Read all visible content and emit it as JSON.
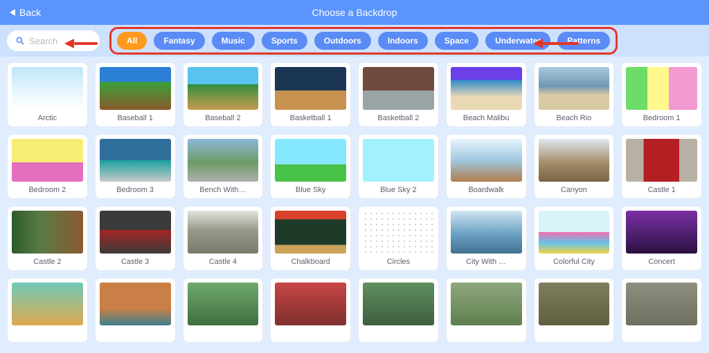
{
  "header": {
    "back_label": "Back",
    "title": "Choose a Backdrop"
  },
  "search": {
    "placeholder": "Search"
  },
  "categories": [
    {
      "label": "All",
      "active": true
    },
    {
      "label": "Fantasy",
      "active": false
    },
    {
      "label": "Music",
      "active": false
    },
    {
      "label": "Sports",
      "active": false
    },
    {
      "label": "Outdoors",
      "active": false
    },
    {
      "label": "Indoors",
      "active": false
    },
    {
      "label": "Space",
      "active": false
    },
    {
      "label": "Underwater",
      "active": false
    },
    {
      "label": "Patterns",
      "active": false
    }
  ],
  "backdrops": [
    {
      "label": "Arctic",
      "bg": "linear-gradient(180deg,#bfe6f7 0%,#e9f6fd 60%,#ffffff 100%)"
    },
    {
      "label": "Baseball 1",
      "bg": "linear-gradient(180deg,#2b7fd6 0%,#2b7fd6 35%,#3aa13a 35%,#8a5a2a 100%)"
    },
    {
      "label": "Baseball 2",
      "bg": "linear-gradient(180deg,#59c2ee 0%,#59c2ee 40%,#2f8f3a 40%,#c79a52 100%)"
    },
    {
      "label": "Basketball 1",
      "bg": "linear-gradient(180deg,#1b3555 0%,#1b3555 55%,#c7924f 55%,#c7924f 100%)"
    },
    {
      "label": "Basketball 2",
      "bg": "linear-gradient(180deg,#6e4b3e 0%,#6e4b3e 55%,#9aa4a6 55%,#9aa4a6 100%)"
    },
    {
      "label": "Beach Malibu",
      "bg": "linear-gradient(180deg,#6b3ee8 0%,#6b3ee8 30%,#2d88c9 30%,#e9d9b4 70%,#e9d9b4 100%)"
    },
    {
      "label": "Beach Rio",
      "bg": "linear-gradient(180deg,#a9c9de 0%,#7198b3 45%,#d9c9a4 65%,#d9c9a4 100%)"
    },
    {
      "label": "Bedroom 1",
      "bg": "linear-gradient(90deg,#6edc68 0%,#6edc68 30%,#fff88a 30%,#fff88a 60%,#f49ad2 60%,#f49ad2 100%)"
    },
    {
      "label": "Bedroom 2",
      "bg": "linear-gradient(180deg,#f7ed74 0%,#f7ed74 55%,#e46fbe 55%,#e46fbe 100%)"
    },
    {
      "label": "Bedroom 3",
      "bg": "linear-gradient(180deg,#2f6f9c 0%,#2f6f9c 50%,#1aa0a0 50%,#c9c9c9 100%)"
    },
    {
      "label": "Bench With…",
      "bg": "linear-gradient(180deg,#8cb8d8 0%,#6b9a66 55%,#b0b0b0 100%)"
    },
    {
      "label": "Blue Sky",
      "bg": "linear-gradient(180deg,#86e8ff 0%,#86e8ff 60%,#49c24a 60%,#49c24a 100%)"
    },
    {
      "label": "Blue Sky 2",
      "bg": "linear-gradient(180deg,#a2f2fd 0%,#a2f2fd 100%)"
    },
    {
      "label": "Boardwalk",
      "bg": "linear-gradient(180deg,#e8f4fb 0%,#9fc8e0 50%,#b07c4e 100%)"
    },
    {
      "label": "Canyon",
      "bg": "linear-gradient(180deg,#dfeaf2 0%,#a58e6a 55%,#7a6347 100%)"
    },
    {
      "label": "Castle 1",
      "bg": "linear-gradient(90deg,#b8b0a4 0%,#b8b0a4 25%,#b41f24 25%,#b41f24 75%,#b8b0a4 75%,#b8b0a4 100%)"
    },
    {
      "label": "Castle 2",
      "bg": "linear-gradient(90deg,#2d5a2a 0%,#5a7a45 40%,#8a5a33 100%)"
    },
    {
      "label": "Castle 3",
      "bg": "linear-gradient(180deg,#3b3b3b 0%,#3b3b3b 45%,#a52424 45%,#3b3b3b 100%)"
    },
    {
      "label": "Castle 4",
      "bg": "linear-gradient(180deg,#e2e4e0 0%,#9a9a8a 45%,#7a7a6a 100%)"
    },
    {
      "label": "Chalkboard",
      "bg": "linear-gradient(180deg,#d9412b 0%,#d9412b 20%,#1e3b2a 20%,#1e3b2a 80%,#caa25a 80%)"
    },
    {
      "label": "Circles",
      "bg": "radial-gradient(circle,#bdbdbd 1px,transparent 1px) 0 0/8px 8px,#fff"
    },
    {
      "label": "City With …",
      "bg": "linear-gradient(180deg,#cfe6f2 0%,#6aa0c4 55%,#43718f 100%)"
    },
    {
      "label": "Colorful City",
      "bg": "linear-gradient(180deg,#d9f3fb 0%,#d9f3fb 50%,#f26fb1 50%,#62c4e6 75%,#f2d14a 100%)"
    },
    {
      "label": "Concert",
      "bg": "linear-gradient(180deg,#7a2fa3 0%,#4a1f6b 60%,#2a0f3f 100%)"
    },
    {
      "label": "",
      "bg": "linear-gradient(180deg,#6fcab8 0%,#e0a94e 100%)"
    },
    {
      "label": "",
      "bg": "linear-gradient(180deg,#c97f45 0%,#c97f45 60%,#3f7f8f 100%)"
    },
    {
      "label": "",
      "bg": "linear-gradient(180deg,#6fa86f 0%,#3f6f3f 100%)"
    },
    {
      "label": "",
      "bg": "linear-gradient(180deg,#c94545 0%,#7f2f2f 100%)"
    },
    {
      "label": "",
      "bg": "linear-gradient(180deg,#5f8f5f 0%,#3f5f3f 100%)"
    },
    {
      "label": "",
      "bg": "linear-gradient(180deg,#8fa87f 0%,#5f7f4f 100%)"
    },
    {
      "label": "",
      "bg": "linear-gradient(180deg,#7f7f5f 0%,#5f5f3f 100%)"
    },
    {
      "label": "",
      "bg": "linear-gradient(180deg,#8f8f7f 0%,#6f6f5f 100%)"
    }
  ]
}
